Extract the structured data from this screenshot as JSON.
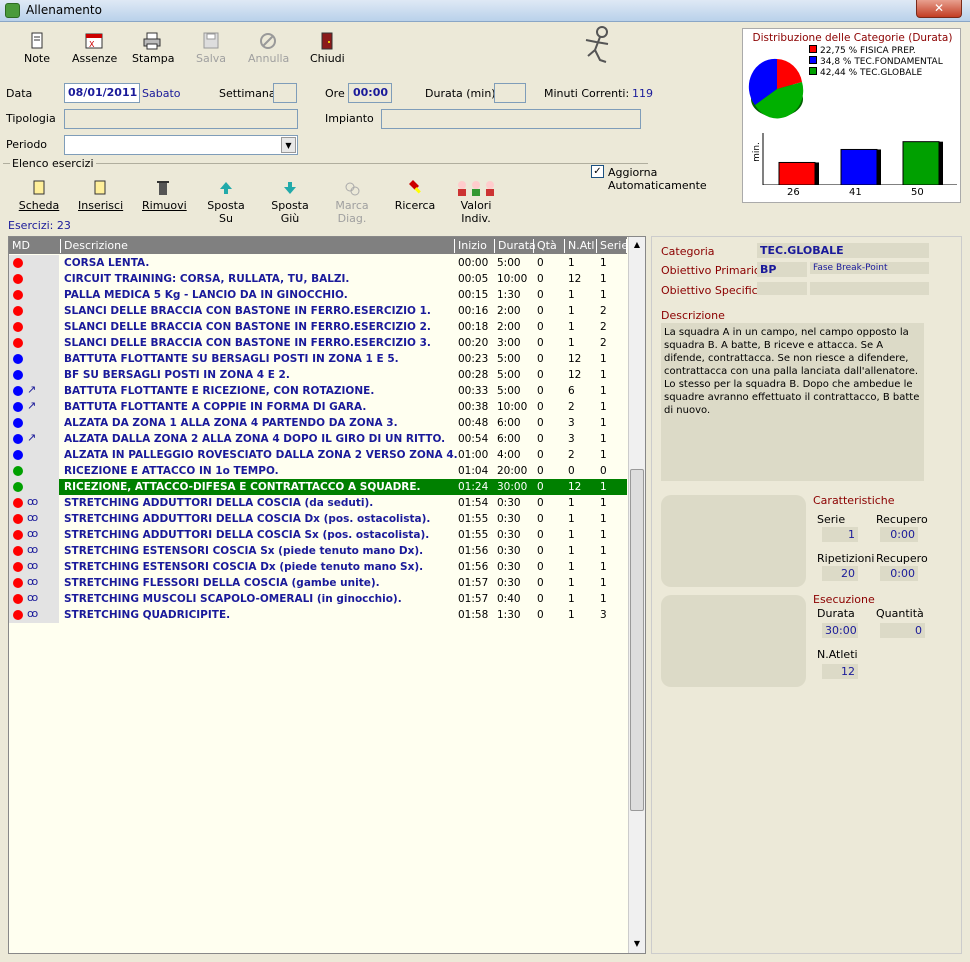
{
  "window": {
    "title": "Allenamento",
    "close": "✕"
  },
  "toolbar": {
    "note": "Note",
    "assenze": "Assenze",
    "stampa": "Stampa",
    "salva": "Salva",
    "annulla": "Annulla",
    "chiudi": "Chiudi"
  },
  "form": {
    "data_label": "Data",
    "data_value": "08/01/2011",
    "day": "Sabato",
    "settimana_label": "Settimana",
    "ore_label": "Ore",
    "ore_value": "00:00",
    "durata_label": "Durata (min)",
    "minuti_label": "Minuti Correnti:",
    "minuti_value": "119",
    "tipologia_label": "Tipologia",
    "impianto_label": "Impianto",
    "periodo_label": "Periodo"
  },
  "chart": {
    "title": "Distribuzione delle Categorie (Durata)",
    "legend": [
      {
        "text": "22,75 % FISICA PREP.",
        "color": "#ff0000"
      },
      {
        "text": "34,8 % TEC.FONDAMENTAL",
        "color": "#0000ff"
      },
      {
        "text": "42,44 % TEC.GLOBALE",
        "color": "#00a000"
      }
    ],
    "ylabel": "min.",
    "bars": [
      {
        "value": 26,
        "color": "#ff0000"
      },
      {
        "value": 41,
        "color": "#0000ff"
      },
      {
        "value": 50,
        "color": "#00a000"
      }
    ],
    "auto_update": "Aggiorna Automaticamente"
  },
  "elenco": {
    "title": "Elenco esercizi",
    "count_label": "Esercizi: 23",
    "buttons": {
      "scheda": "Scheda",
      "inserisci": "Inserisci",
      "rimuovi": "Rimuovi",
      "sposta_su": "Sposta Su",
      "sposta_giu": "Sposta Giù",
      "marca": "Marca Diag.",
      "ricerca": "Ricerca",
      "valori": "Valori Indiv."
    }
  },
  "grid": {
    "headers": {
      "md": "MD",
      "desc": "Descrizione",
      "inizio": "Inizio",
      "durata": "Durata",
      "qta": "Qtà",
      "natl": "N.Atl",
      "serie": "Serie"
    },
    "rows": [
      {
        "c": "#ff0000",
        "i": "",
        "d": "CORSA LENTA.",
        "s": "00:00",
        "du": "5:00",
        "q": "0",
        "n": "1",
        "se": "1"
      },
      {
        "c": "#ff0000",
        "i": "",
        "d": "CIRCUIT TRAINING: CORSA, RULLATA, TU, BALZI.",
        "s": "00:05",
        "du": "10:00",
        "q": "0",
        "n": "12",
        "se": "1"
      },
      {
        "c": "#ff0000",
        "i": "",
        "d": "PALLA MEDICA 5 Kg - LANCIO DA IN GINOCCHIO.",
        "s": "00:15",
        "du": "1:30",
        "q": "0",
        "n": "1",
        "se": "1"
      },
      {
        "c": "#ff0000",
        "i": "",
        "d": "SLANCI DELLE BRACCIA CON BASTONE IN FERRO.ESERCIZIO 1.",
        "s": "00:16",
        "du": "2:00",
        "q": "0",
        "n": "1",
        "se": "2"
      },
      {
        "c": "#ff0000",
        "i": "",
        "d": "SLANCI DELLE BRACCIA CON BASTONE IN FERRO.ESERCIZIO 2.",
        "s": "00:18",
        "du": "2:00",
        "q": "0",
        "n": "1",
        "se": "2"
      },
      {
        "c": "#ff0000",
        "i": "",
        "d": "SLANCI DELLE BRACCIA CON BASTONE IN FERRO.ESERCIZIO 3.",
        "s": "00:20",
        "du": "3:00",
        "q": "0",
        "n": "1",
        "se": "2"
      },
      {
        "c": "#0000ff",
        "i": "",
        "d": "BATTUTA FLOTTANTE SU BERSAGLI POSTI IN ZONA 1 E 5.",
        "s": "00:23",
        "du": "5:00",
        "q": "0",
        "n": "12",
        "se": "1"
      },
      {
        "c": "#0000ff",
        "i": "",
        "d": "BF SU BERSAGLI POSTI IN ZONA 4 E 2.",
        "s": "00:28",
        "du": "5:00",
        "q": "0",
        "n": "12",
        "se": "1"
      },
      {
        "c": "#0000ff",
        "i": "↗",
        "d": "BATTUTA FLOTTANTE E RICEZIONE, CON ROTAZIONE.",
        "s": "00:33",
        "du": "5:00",
        "q": "0",
        "n": "6",
        "se": "1"
      },
      {
        "c": "#0000ff",
        "i": "↗",
        "d": "BATTUTA FLOTTANTE A COPPIE IN FORMA DI GARA.",
        "s": "00:38",
        "du": "10:00",
        "q": "0",
        "n": "2",
        "se": "1"
      },
      {
        "c": "#0000ff",
        "i": "",
        "d": "ALZATA DA ZONA 1 ALLA ZONA 4 PARTENDO DA ZONA 3.",
        "s": "00:48",
        "du": "6:00",
        "q": "0",
        "n": "3",
        "se": "1"
      },
      {
        "c": "#0000ff",
        "i": "↗",
        "d": "ALZATA DALLA ZONA 2 ALLA ZONA 4 DOPO IL GIRO DI UN RITTO.",
        "s": "00:54",
        "du": "6:00",
        "q": "0",
        "n": "3",
        "se": "1"
      },
      {
        "c": "#0000ff",
        "i": "",
        "d": "ALZATA IN PALLEGGIO ROVESCIATO DALLA ZONA 2 VERSO ZONA 4.",
        "s": "01:00",
        "du": "4:00",
        "q": "0",
        "n": "2",
        "se": "1"
      },
      {
        "c": "#00a000",
        "i": "",
        "d": "RICEZIONE E ATTACCO IN 1o TEMPO.",
        "s": "01:04",
        "du": "20:00",
        "q": "0",
        "n": "0",
        "se": "0"
      },
      {
        "c": "#00a000",
        "i": "",
        "d": "RICEZIONE, ATTACCO-DIFESA E CONTRATTACCO A SQUADRE.",
        "s": "01:24",
        "du": "30:00",
        "q": "0",
        "n": "12",
        "se": "1",
        "sel": true
      },
      {
        "c": "#ff0000",
        "i": "ꝏ",
        "d": "STRETCHING ADDUTTORI DELLA COSCIA (da seduti).",
        "s": "01:54",
        "du": "0:30",
        "q": "0",
        "n": "1",
        "se": "1"
      },
      {
        "c": "#ff0000",
        "i": "ꝏ",
        "d": "STRETCHING ADDUTTORI DELLA COSCIA Dx (pos. ostacolista).",
        "s": "01:55",
        "du": "0:30",
        "q": "0",
        "n": "1",
        "se": "1"
      },
      {
        "c": "#ff0000",
        "i": "ꝏ",
        "d": "STRETCHING ADDUTTORI DELLA COSCIA Sx (pos. ostacolista).",
        "s": "01:55",
        "du": "0:30",
        "q": "0",
        "n": "1",
        "se": "1"
      },
      {
        "c": "#ff0000",
        "i": "ꝏ",
        "d": "STRETCHING ESTENSORI COSCIA Sx (piede tenuto mano Dx).",
        "s": "01:56",
        "du": "0:30",
        "q": "0",
        "n": "1",
        "se": "1"
      },
      {
        "c": "#ff0000",
        "i": "ꝏ",
        "d": "STRETCHING ESTENSORI COSCIA Dx (piede tenuto mano Sx).",
        "s": "01:56",
        "du": "0:30",
        "q": "0",
        "n": "1",
        "se": "1"
      },
      {
        "c": "#ff0000",
        "i": "ꝏ",
        "d": "STRETCHING FLESSORI DELLA COSCIA (gambe unite).",
        "s": "01:57",
        "du": "0:30",
        "q": "0",
        "n": "1",
        "se": "1"
      },
      {
        "c": "#ff0000",
        "i": "ꝏ",
        "d": "STRETCHING MUSCOLI SCAPOLO-OMERALI (in ginocchio).",
        "s": "01:57",
        "du": "0:40",
        "q": "0",
        "n": "1",
        "se": "1"
      },
      {
        "c": "#ff0000",
        "i": "ꝏ",
        "d": "STRETCHING QUADRICIPITE.",
        "s": "01:58",
        "du": "1:30",
        "q": "0",
        "n": "1",
        "se": "3"
      }
    ]
  },
  "detail": {
    "categoria_label": "Categoria",
    "categoria_value": "TEC.GLOBALE",
    "obj_primario_label": "Obiettivo Primario",
    "obj_primario_code": "BP",
    "obj_primario_text": "Fase Break-Point",
    "obj_specifico_label": "Obiettivo Specifico",
    "descrizione_label": "Descrizione",
    "descrizione_text": "La squadra A in un campo, nel campo opposto la squadra B. A batte, B riceve e attacca. Se A difende, contrattacca. Se non riesce a difendere, contrattacca con una palla lanciata dall'allenatore. Lo stesso per la squadra B. Dopo che ambedue le squadre avranno effettuato il contrattacco, B batte di nuovo.",
    "caratteristiche_label": "Caratteristiche",
    "serie_label": "Serie",
    "serie_value": "1",
    "recupero_label": "Recupero",
    "recupero1_value": "0:00",
    "ripetizioni_label": "Ripetizioni",
    "ripetizioni_value": "20",
    "recupero2_value": "0:00",
    "esecuzione_label": "Esecuzione",
    "durata_label": "Durata",
    "durata_value": "30:00",
    "quantita_label": "Quantità",
    "quantita_value": "0",
    "natleti_label": "N.Atleti",
    "natleti_value": "12"
  }
}
